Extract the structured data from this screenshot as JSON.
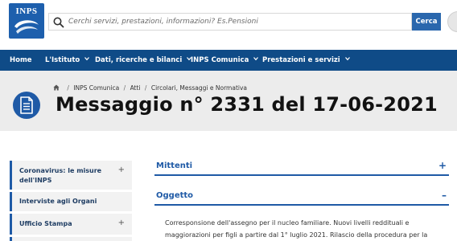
{
  "header": {
    "logo_text": "INPS",
    "search_placeholder": "Cerchi servizi, prestazioni, informazioni? Es.Pensioni",
    "search_button_label": "Cerca"
  },
  "nav": {
    "items": [
      {
        "label": "Home",
        "has_dropdown": false
      },
      {
        "label": "L'Istituto",
        "has_dropdown": true
      },
      {
        "label": "Dati, ricerche e bilanci",
        "has_dropdown": true
      },
      {
        "label": "INPS Comunica",
        "has_dropdown": true
      },
      {
        "label": "Prestazioni e servizi",
        "has_dropdown": true
      }
    ]
  },
  "breadcrumb": {
    "items": [
      "INPS Comunica",
      "Atti",
      "Circolari, Messaggi e Normativa"
    ],
    "separator": "/"
  },
  "page": {
    "title": "Messaggio n° 2331 del 17-06-2021"
  },
  "sidebar": {
    "items": [
      {
        "label_line1": "Coronavirus: le misure",
        "label_line2": "dell'INPS",
        "toggle": "+"
      },
      {
        "label_line1": "Interviste agli Organi",
        "label_line2": "",
        "toggle": ""
      },
      {
        "label_line1": "Ufficio Stampa",
        "label_line2": "",
        "toggle": "+"
      },
      {
        "label_line1": "",
        "label_line2": "",
        "toggle": "+"
      }
    ]
  },
  "sections": [
    {
      "title": "Mittenti",
      "toggle": "+"
    },
    {
      "title": "Oggetto",
      "toggle": "–"
    }
  ],
  "oggetto_text": {
    "line1": "Corresponsione dell'assegno per il nucleo familiare. Nuovi livelli reddituali e",
    "line2": "maggiorazioni per figli a partire dal 1° luglio 2021. Rilascio della procedura per la"
  },
  "colors": {
    "brand_blue": "#1f5aa6",
    "nav_blue": "#0f4b87",
    "title_band": "#ececec"
  }
}
